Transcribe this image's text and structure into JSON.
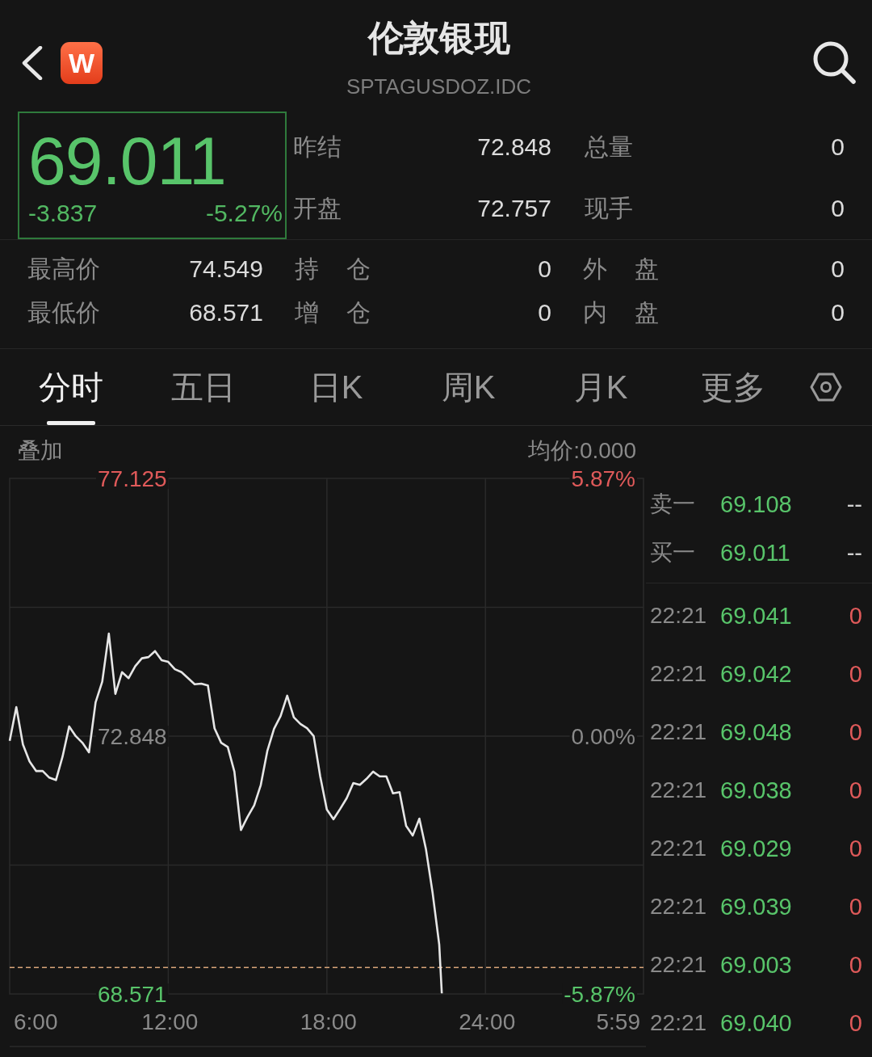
{
  "header": {
    "logo_text": "W",
    "title": "伦敦银现",
    "code": "SPTAGUSDOZ.IDC"
  },
  "quote": {
    "price": "69.011",
    "change": "-3.837",
    "change_pct": "-5.27%"
  },
  "stats": [
    {
      "label": "昨结",
      "value": "72.848"
    },
    {
      "label": "总量",
      "value": "0"
    },
    {
      "label": "开盘",
      "value": "72.757"
    },
    {
      "label": "现手",
      "value": "0"
    }
  ],
  "details": [
    {
      "label": "最高价",
      "value": "74.549"
    },
    {
      "label": "持 仓",
      "value": "0"
    },
    {
      "label": "外 盘",
      "value": "0"
    },
    {
      "label": "最低价",
      "value": "68.571"
    },
    {
      "label": "增 仓",
      "value": "0"
    },
    {
      "label": "内 盘",
      "value": "0"
    }
  ],
  "tabs": [
    {
      "label": "分时",
      "selected": true
    },
    {
      "label": "五日",
      "selected": false
    },
    {
      "label": "日K",
      "selected": false
    },
    {
      "label": "周K",
      "selected": false
    },
    {
      "label": "月K",
      "selected": false
    },
    {
      "label": "更多",
      "selected": false
    }
  ],
  "chart": {
    "overlay_label": "叠加",
    "avg_price": "均价:0.000",
    "percent_labels": [
      "5.87%",
      "0.00%",
      "-5.87%"
    ],
    "session_end_label": "5:59",
    "chart_data": {
      "type": "line",
      "grid": true,
      "x": [
        6,
        6.25,
        6.5,
        6.75,
        7,
        7.25,
        7.5,
        7.75,
        8,
        8.25,
        8.5,
        8.75,
        9,
        9.25,
        9.5,
        9.75,
        10,
        10.25,
        10.5,
        10.75,
        11,
        11.25,
        11.5,
        11.75,
        12,
        12.25,
        12.5,
        12.75,
        13,
        13.25,
        13.5,
        13.75,
        14,
        14.25,
        14.5,
        14.75,
        15,
        15.25,
        15.5,
        15.75,
        16,
        16.25,
        16.5,
        16.75,
        17,
        17.25,
        17.5,
        17.75,
        18,
        18.25,
        18.5,
        18.75,
        19,
        19.25,
        19.5,
        19.75,
        20,
        20.25,
        20.5,
        20.75,
        21,
        21.25,
        21.5,
        21.75,
        22,
        22.25,
        22.35
      ],
      "series": [
        {
          "color": "#e6e6e6",
          "values": [
            72.77,
            73.33,
            72.71,
            72.43,
            72.27,
            72.27,
            72.16,
            72.12,
            72.51,
            73.01,
            72.85,
            72.74,
            72.58,
            73.41,
            73.75,
            74.55,
            73.55,
            73.91,
            73.81,
            74.01,
            74.14,
            74.16,
            74.26,
            74.11,
            74.08,
            73.96,
            73.91,
            73.81,
            73.71,
            73.72,
            73.69,
            72.98,
            72.74,
            72.67,
            72.26,
            71.29,
            71.51,
            71.7,
            72.04,
            72.61,
            72.97,
            73.18,
            73.52,
            73.16,
            73.05,
            72.98,
            72.85,
            72.18,
            71.63,
            71.47,
            71.64,
            71.82,
            72.07,
            72.04,
            72.14,
            72.26,
            72.18,
            72.18,
            71.9,
            71.92,
            71.36,
            71.2,
            71.48,
            70.97,
            70.25,
            69.39,
            68.58
          ]
        }
      ],
      "xlim": [
        6,
        29.98
      ],
      "ylim": [
        68.571,
        77.125
      ],
      "xticks": [
        {
          "value": 6,
          "label": "6:00"
        },
        {
          "value": 12,
          "label": "12:00"
        },
        {
          "value": 18,
          "label": "18:00"
        },
        {
          "value": 24,
          "label": "24:00"
        }
      ],
      "yticks": [
        {
          "value": 77.125,
          "label": "77.125"
        },
        {
          "value": 72.848,
          "label": "72.848"
        },
        {
          "value": 68.571,
          "label": "68.571"
        }
      ],
      "ref_lines": [
        {
          "axis": "y",
          "value": 69.011,
          "color": "#d9a57a"
        }
      ]
    }
  },
  "order_book": [
    {
      "label": "卖一",
      "price": "69.108",
      "volume": "--"
    },
    {
      "label": "买一",
      "price": "69.011",
      "volume": "--"
    }
  ],
  "trades": [
    {
      "time": "22:21",
      "price": "69.041",
      "volume": "0"
    },
    {
      "time": "22:21",
      "price": "69.042",
      "volume": "0"
    },
    {
      "time": "22:21",
      "price": "69.048",
      "volume": "0"
    },
    {
      "time": "22:21",
      "price": "69.038",
      "volume": "0"
    },
    {
      "time": "22:21",
      "price": "69.029",
      "volume": "0"
    },
    {
      "time": "22:21",
      "price": "69.039",
      "volume": "0"
    },
    {
      "time": "22:21",
      "price": "69.003",
      "volume": "0"
    },
    {
      "time": "22:21",
      "price": "69.040",
      "volume": "0"
    }
  ]
}
